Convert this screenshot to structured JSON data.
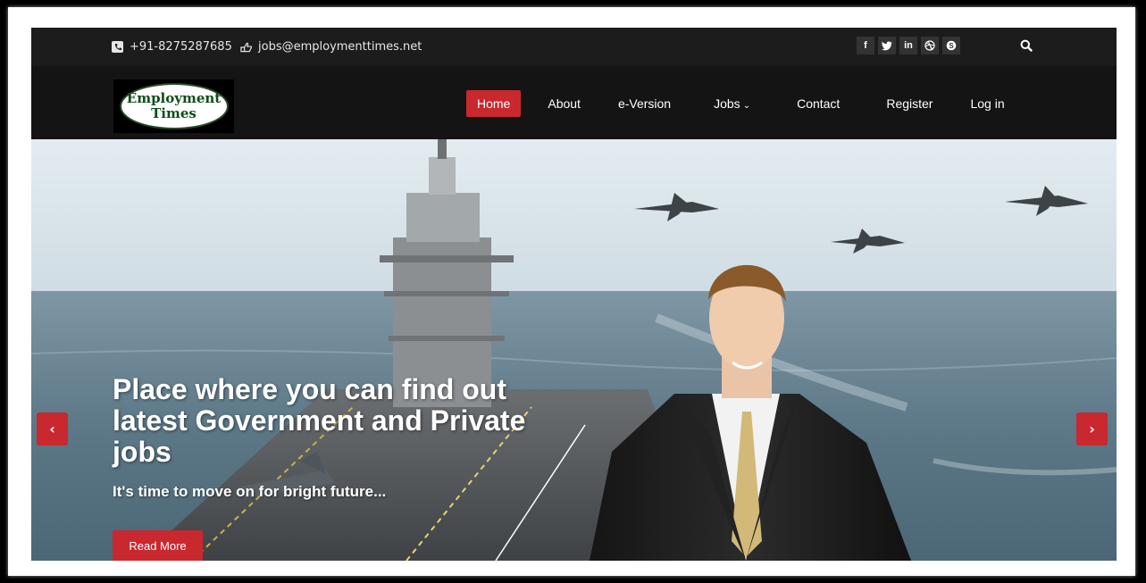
{
  "topbar": {
    "phone": "+91-8275287685",
    "email": "jobs@employmenttimes.net",
    "social": [
      {
        "icon": "facebook-icon",
        "glyph": "f"
      },
      {
        "icon": "twitter-icon",
        "glyph": "t"
      },
      {
        "icon": "linkedin-icon",
        "glyph": "in"
      },
      {
        "icon": "dribbble-icon",
        "glyph": "✇"
      },
      {
        "icon": "skype-icon",
        "glyph": "S"
      }
    ],
    "search_icon": "search-icon"
  },
  "logo": {
    "line1": "Employment",
    "line2": "Times"
  },
  "nav": {
    "items": [
      {
        "label": "Home"
      },
      {
        "label": "About"
      },
      {
        "label": "e-Version"
      },
      {
        "label": "Jobs"
      },
      {
        "label": "Contact"
      },
      {
        "label": "Register"
      },
      {
        "label": "Log in"
      }
    ],
    "active": "Home",
    "accent": "#c8282e"
  },
  "hero": {
    "title": "Place where you can find out latest Government and Private jobs",
    "subtitle": "It's time to move on for bright future...",
    "button": "Read More",
    "prev_glyph": "‹",
    "next_glyph": "›"
  }
}
